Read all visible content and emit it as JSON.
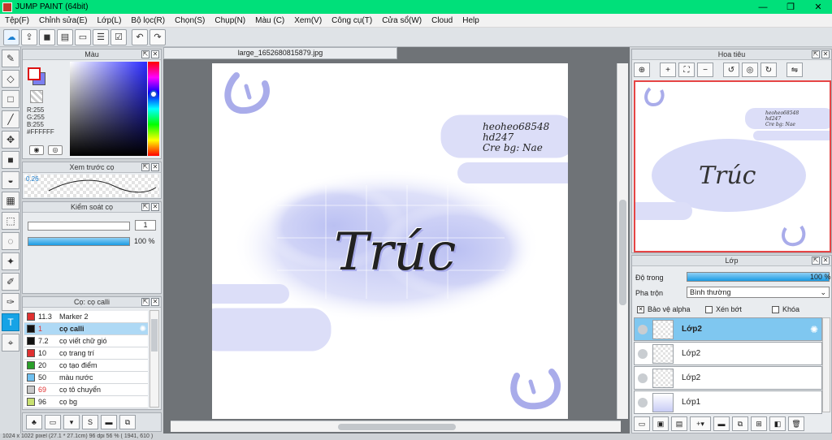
{
  "window": {
    "title": "JUMP PAINT (64bit)",
    "controls": [
      "—",
      "❐",
      "✕"
    ]
  },
  "menu": [
    "Tệp(F)",
    "Chỉnh sửa(E)",
    "Lớp(L)",
    "Bộ lọc(R)",
    "Chọn(S)",
    "Chụp(N)",
    "Màu (C)",
    "Xem(V)",
    "Công cụ(T)",
    "Cửa sổ(W)",
    "Cloud",
    "Help"
  ],
  "document": {
    "tab_title": "large_1652680815879.jpg",
    "credit_lines": [
      "heoheo68548",
      "hd247",
      "Cre bg: Nae"
    ],
    "main_text": "Trúc"
  },
  "color_panel": {
    "title": "Màu",
    "rgb_r": "R:255",
    "rgb_g": "G:255",
    "rgb_b": "B:255",
    "hex": "#FFFFFF"
  },
  "brush_preview": {
    "title": "Xem trước cọ",
    "size": "0.26"
  },
  "brush_control": {
    "title": "Kiểm soát cọ",
    "size_value": "1",
    "opacity_label": "100 %",
    "opacity_fraction": 1.0
  },
  "brush_list": {
    "title": "Cọ: cọ calli",
    "items": [
      {
        "size": "11.3",
        "name": "Marker 2",
        "color": "#e03030",
        "size_color": "#222"
      },
      {
        "size": "1",
        "name": "cọ calli",
        "color": "#111111",
        "size_color": "#e03030"
      },
      {
        "size": "7.2",
        "name": "cọ viết chữ gió",
        "color": "#111111",
        "size_color": "#222"
      },
      {
        "size": "10",
        "name": "cọ trang trí",
        "color": "#e03030",
        "size_color": "#222"
      },
      {
        "size": "20",
        "name": "cọ tạo điểm",
        "color": "#2aa02a",
        "size_color": "#222"
      },
      {
        "size": "50",
        "name": "màu nước",
        "color": "#6fc0f0",
        "size_color": "#222"
      },
      {
        "size": "69",
        "name": "cọ tô chuyển",
        "color": "#c8c8c8",
        "size_color": "#e03030"
      },
      {
        "size": "96",
        "name": "cọ bg",
        "color": "#c8e070",
        "size_color": "#222"
      }
    ],
    "selected_index": 1
  },
  "navigator": {
    "title": "Hoa tiêu"
  },
  "layers": {
    "title": "Lớp",
    "opacity_label": "Độ trong",
    "opacity_value": "100 %",
    "blend_label": "Pha trộn",
    "blend_value": "Bình thường",
    "alpha_protect": "Bảo vệ alpha",
    "clipping": "Xén bớt",
    "lock": "Khóa",
    "items": [
      {
        "name": "Lớp2",
        "selected": true
      },
      {
        "name": "Lớp2",
        "selected": false
      },
      {
        "name": "Lớp2",
        "selected": false
      },
      {
        "name": "Lớp1",
        "selected": false
      }
    ]
  },
  "status": {
    "text": "1024 x 1022 pixel   (27.1 * 27.1cm)   96 dpi   56 %   ( 1941, 610 )"
  }
}
